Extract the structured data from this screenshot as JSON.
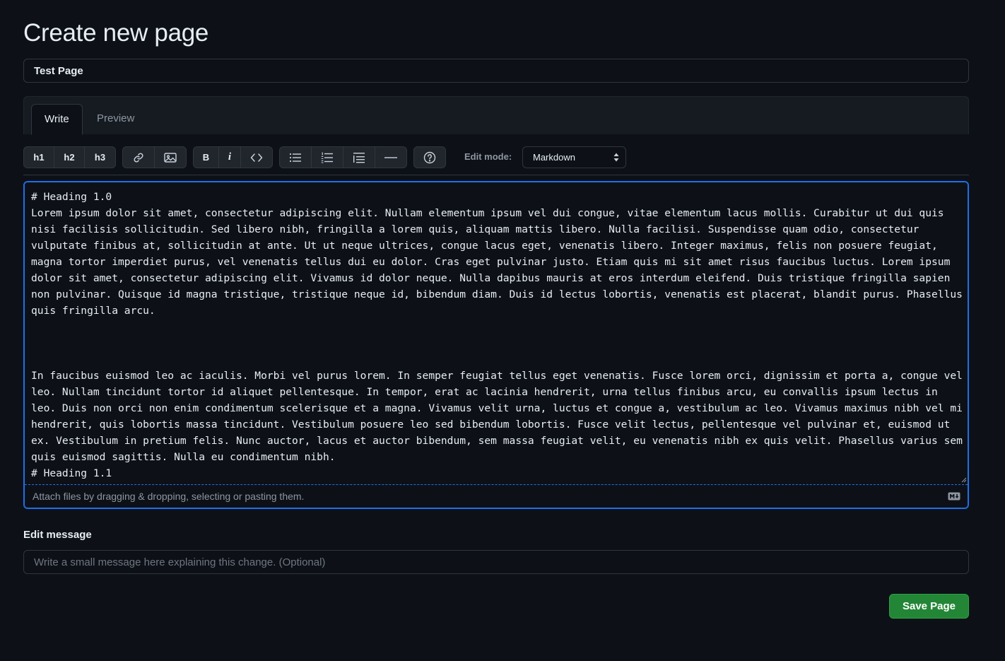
{
  "page": {
    "title": "Create new page"
  },
  "form": {
    "title_value": "Test Page",
    "tabs": [
      {
        "label": "Write",
        "active": true
      },
      {
        "label": "Preview",
        "active": false
      }
    ],
    "toolbar": {
      "headings": [
        "h1",
        "h2",
        "h3"
      ],
      "bold": "B",
      "italic": "i",
      "edit_mode_label": "Edit mode:",
      "edit_mode_value": "Markdown",
      "icons": [
        "link-icon",
        "image-icon",
        "code-icon",
        "unordered-list-icon",
        "ordered-list-icon",
        "task-list-icon",
        "horizontal-rule-icon",
        "help-icon"
      ]
    },
    "editor": {
      "content": "# Heading 1.0\nLorem ipsum dolor sit amet, consectetur adipiscing elit. Nullam elementum ipsum vel dui congue, vitae elementum lacus mollis. Curabitur ut dui quis nisi facilisis sollicitudin. Sed libero nibh, fringilla a lorem quis, aliquam mattis libero. Nulla facilisi. Suspendisse quam odio, consectetur vulputate finibus at, sollicitudin at ante. Ut ut neque ultrices, congue lacus eget, venenatis libero. Integer maximus, felis non posuere feugiat, magna tortor imperdiet purus, vel venenatis tellus dui eu dolor. Cras eget pulvinar justo. Etiam quis mi sit amet risus faucibus luctus. Lorem ipsum dolor sit amet, consectetur adipiscing elit. Vivamus id dolor neque. Nulla dapibus mauris at eros interdum eleifend. Duis tristique fringilla sapien non pulvinar. Quisque id magna tristique, tristique neque id, bibendum diam. Duis id lectus lobortis, venenatis est placerat, blandit purus. Phasellus quis fringilla arcu.\n\n\n\nIn faucibus euismod leo ac iaculis. Morbi vel purus lorem. In semper feugiat tellus eget venenatis. Fusce lorem orci, dignissim et porta a, congue vel leo. Nullam tincidunt tortor id aliquet pellentesque. In tempor, erat ac lacinia hendrerit, urna tellus finibus arcu, eu convallis ipsum lectus in leo. Duis non orci non enim condimentum scelerisque et a magna. Vivamus velit urna, luctus et congue a, vestibulum ac leo. Vivamus maximus nibh vel mi hendrerit, quis lobortis massa tincidunt. Vestibulum posuere leo sed bibendum lobortis. Fusce velit lectus, pellentesque vel pulvinar et, euismod ut ex. Vestibulum in pretium felis. Nunc auctor, lacus et auctor bibendum, sem massa feugiat velit, eu venenatis nibh ex quis velit. Phasellus varius sem quis euismod sagittis. Nulla eu condimentum nibh.\n# Heading 1.1",
      "attach_text": "Attach files by dragging & dropping, selecting or pasting them."
    },
    "message": {
      "label": "Edit message",
      "placeholder": "Write a small message here explaining this change. (Optional)"
    },
    "save_label": "Save Page"
  },
  "colors": {
    "accent": "#1f6feb",
    "save": "#238636",
    "background": "#0d1117"
  }
}
